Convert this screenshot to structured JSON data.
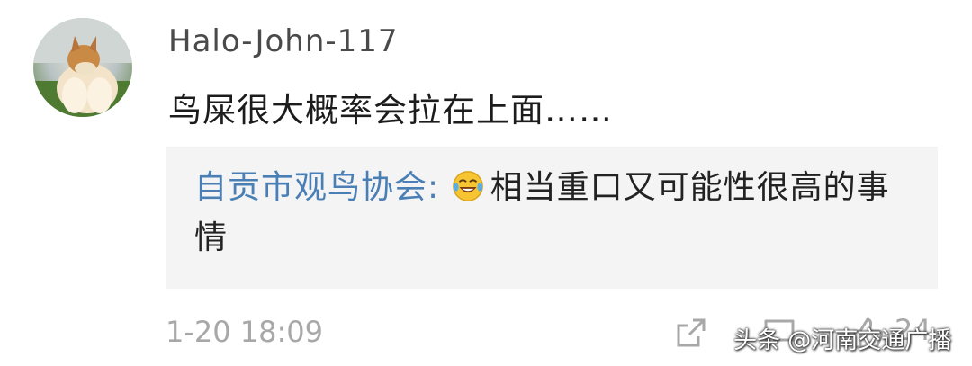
{
  "comment": {
    "username": "Halo-John-117",
    "text": "鸟屎很大概率会拉在上面……",
    "timestamp": "1-20 18:09"
  },
  "reply": {
    "author": "自贡市观鸟协会:",
    "emoji_icon": "laughing-tears-emoji",
    "text": "相当重口又可能性很高的事情"
  },
  "actions": {
    "like_count": "24"
  },
  "watermark": "头条 @河南交通广播",
  "colors": {
    "author_link": "#4a7fb5",
    "reply_bg": "#f4f4f4",
    "meta_gray": "#a8a8a8"
  }
}
